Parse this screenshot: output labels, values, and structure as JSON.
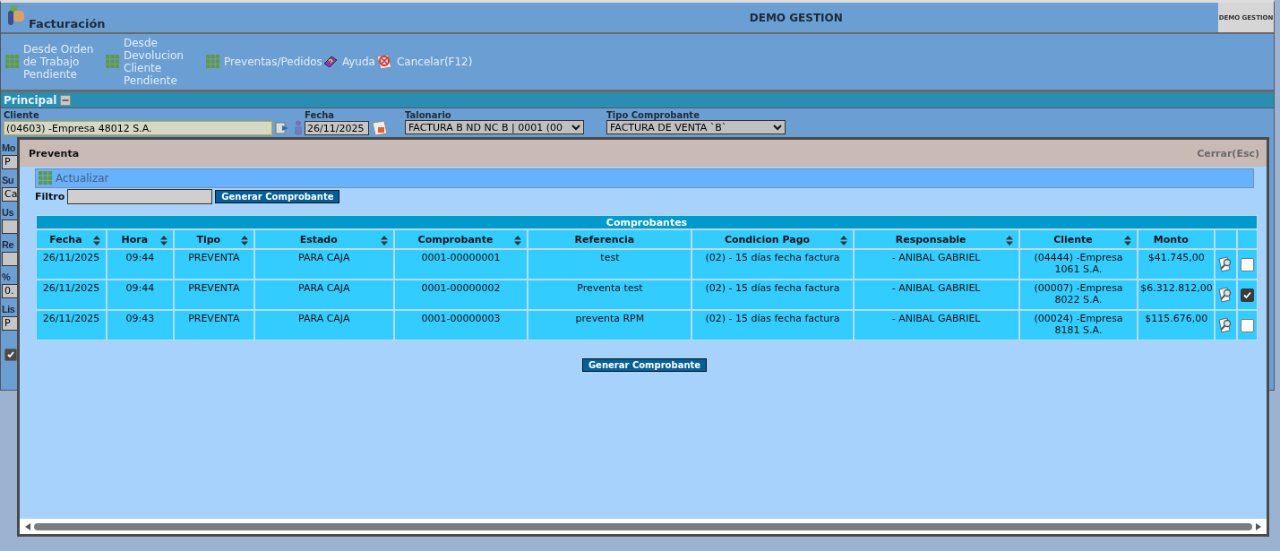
{
  "app": {
    "title": "Facturación",
    "company": "DEMO GESTION",
    "logo_text": "DEMO GESTION"
  },
  "toolbar": [
    {
      "label": "Desde Orden de Trabajo Pendiente",
      "kind": "grid"
    },
    {
      "label": "Desde Devolucion Cliente Pendiente",
      "kind": "grid"
    },
    {
      "label": "Preventas/Pedidos",
      "kind": "grid"
    },
    {
      "label": "Ayuda",
      "kind": "help"
    },
    {
      "label": "Cancelar(F12)",
      "kind": "cancel"
    }
  ],
  "section": {
    "title": "Principal",
    "expanded": true
  },
  "form": [
    {
      "label": "Cliente",
      "value": "(04603) -Empresa 48012 S.A.",
      "kind": "client"
    },
    {
      "label": "Fecha",
      "value": "26/11/2025",
      "kind": "date"
    },
    {
      "label": "Talonario",
      "value": "FACTURA B ND NC B | 0001 (00",
      "kind": "select"
    },
    {
      "label": "Tipo Comprobante",
      "value": "FACTURA DE VENTA `B`",
      "kind": "select"
    }
  ],
  "side_fields": [
    {
      "label": "Mo",
      "value": "P"
    },
    {
      "label": "Su",
      "value": "Ca"
    },
    {
      "label": "Us"
    },
    {
      "label": "Re"
    },
    {
      "label": "%",
      "value": "0."
    },
    {
      "label": "Lis",
      "value": "P"
    }
  ],
  "side_checkbox": {
    "checked": true
  },
  "modal": {
    "title": "Preventa",
    "close": "Cerrar(Esc)",
    "refresh": "Actualizar",
    "filter_label": "Filtro",
    "generate_button": "Generar Comprobante",
    "footer_button": "Generar Comprobante",
    "table": {
      "caption": "Comprobantes",
      "columns": [
        {
          "label": "Fecha",
          "sortable": true
        },
        {
          "label": "Hora",
          "sortable": true
        },
        {
          "label": "Tipo",
          "sortable": true
        },
        {
          "label": "Estado",
          "sortable": true
        },
        {
          "label": "Comprobante",
          "sortable": true
        },
        {
          "label": "Referencia",
          "sortable": false
        },
        {
          "label": "Condicion Pago",
          "sortable": true
        },
        {
          "label": "Responsable",
          "sortable": true
        },
        {
          "label": "Cliente",
          "sortable": true
        },
        {
          "label": "Monto",
          "sortable": false
        }
      ],
      "rows": [
        {
          "cells": [
            "26/11/2025",
            "09:44",
            "PREVENTA",
            "PARA CAJA",
            "0001-00000001",
            "test",
            "(02) - 15 días fecha factura",
            "- ANIBAL GABRIEL",
            "(04444) -Empresa 1061 S.A.",
            "$41.745,00"
          ],
          "selected": false
        },
        {
          "cells": [
            "26/11/2025",
            "09:44",
            "PREVENTA",
            "PARA CAJA",
            "0001-00000002",
            "Preventa test",
            "(02) - 15 días fecha factura",
            "- ANIBAL GABRIEL",
            "(00007) -Empresa 8022 S.A.",
            "$6.312.812,00"
          ],
          "selected": true
        },
        {
          "cells": [
            "26/11/2025",
            "09:43",
            "PREVENTA",
            "PARA CAJA",
            "0001-00000003",
            "preventa RPM",
            "(02) - 15 días fecha factura",
            "- ANIBAL GABRIEL",
            "(00024) -Empresa 8181 S.A.",
            "$115.676,00"
          ],
          "selected": false
        }
      ]
    }
  }
}
